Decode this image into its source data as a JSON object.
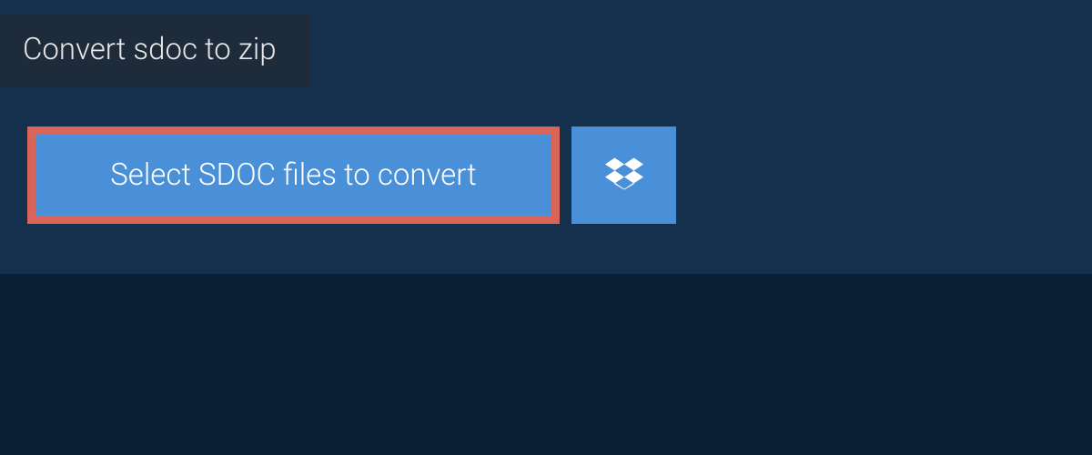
{
  "header": {
    "tab_label": "Convert sdoc to zip"
  },
  "actions": {
    "select_button_label": "Select SDOC files to convert"
  },
  "colors": {
    "page_bg": "#0a1f33",
    "panel_bg": "#14304d",
    "tab_bg": "#1d2b3a",
    "button_bg": "#4a90d9",
    "highlight_border": "#d96459"
  }
}
